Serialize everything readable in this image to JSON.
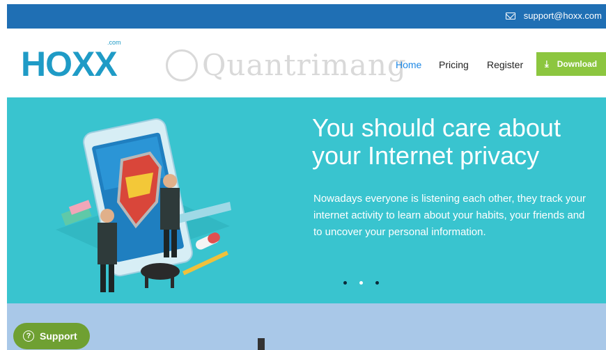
{
  "topbar": {
    "email": "support@hoxx.com"
  },
  "header": {
    "logo": "HOXX",
    "logo_suffix": ".com",
    "watermark": "Quantrimang",
    "nav": [
      {
        "label": "Home",
        "active": true
      },
      {
        "label": "Pricing"
      },
      {
        "label": "Register"
      }
    ],
    "download_label": "Download"
  },
  "hero": {
    "title": "You should care about your Internet privacy",
    "description": "Nowadays everyone is listening each other, they track your internet activity to learn about your habits, your friends and to uncover your personal information.",
    "slide_count": 3,
    "active_slide": 1
  },
  "colors": {
    "topbar": "#1f6fb4",
    "hero": "#39c4cf",
    "download": "#8cc63f",
    "support": "#6fa032",
    "nav_active": "#1e88e5"
  },
  "support": {
    "label": "Support"
  }
}
